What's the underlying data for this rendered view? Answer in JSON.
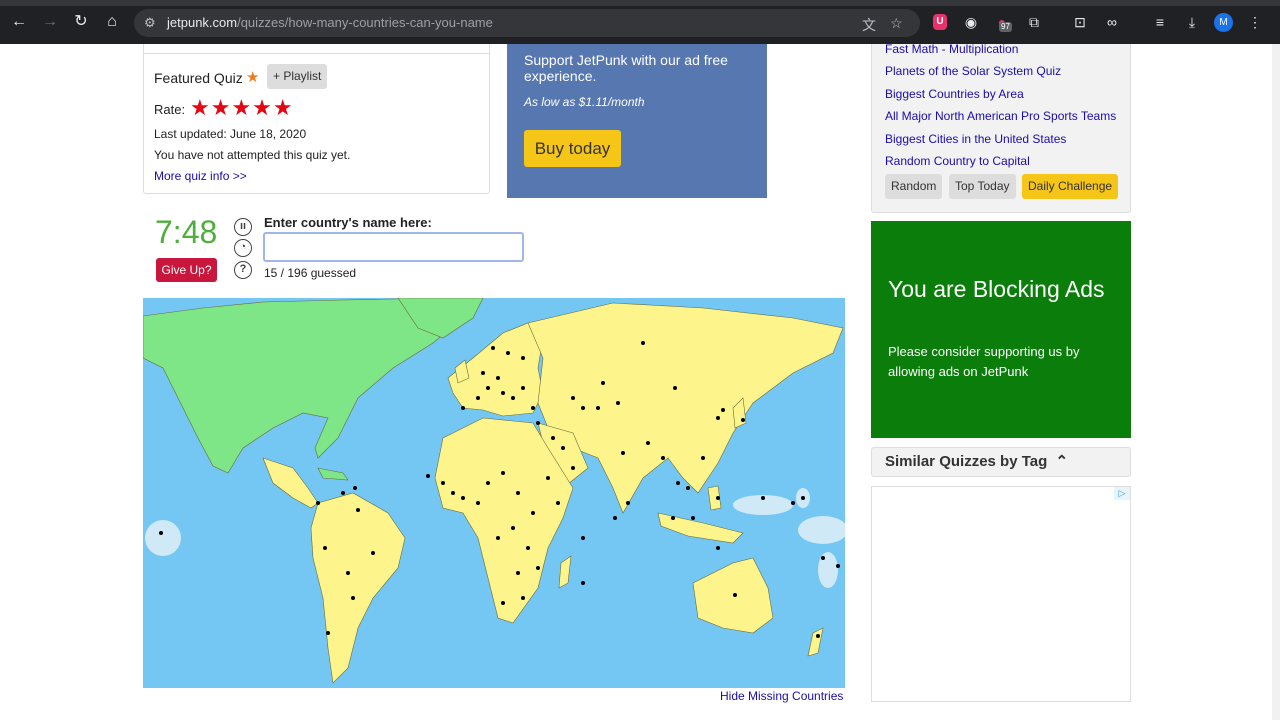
{
  "browser": {
    "url_host": "jetpunk.com",
    "url_path": "/quizzes/how-many-countries-can-you-name",
    "ext_badge": "97",
    "profile_initial": "M"
  },
  "quiz_info": {
    "featured_label": "Featured Quiz",
    "playlist_label": "+ Playlist",
    "rate_label": "Rate:",
    "stars": "★★★★★",
    "last_updated": "Last updated: June 18, 2020",
    "attempt_status": "You have not attempted this quiz yet.",
    "more_info_link": "More quiz info >>"
  },
  "promo": {
    "support_text": "Support JetPunk with our ad free experience.",
    "price_text": "As low as $1.11/month",
    "buy_label": "Buy today"
  },
  "game": {
    "timer": "7:48",
    "give_up_label": "Give Up?",
    "input_label": "Enter country's name here:",
    "input_value": "",
    "guessed_text": "15 / 196 guessed",
    "hide_missing_link": "Hide Missing Countries"
  },
  "sidebar": {
    "links": [
      "Fast Math - Multiplication",
      "Planets of the Solar System Quiz",
      "Biggest Countries by Area",
      "All Major North American Pro Sports Teams",
      "Biggest Cities in the United States",
      "Random Country to Capital"
    ],
    "buttons": {
      "random": "Random",
      "top_today": "Top Today",
      "daily_challenge": "Daily Challenge"
    }
  },
  "blocking_ad": {
    "heading": "You are Blocking Ads",
    "body": "Please consider supporting us by allowing ads on JetPunk"
  },
  "similar": {
    "heading": "Similar Quizzes by Tag",
    "chevron": "^"
  },
  "colors": {
    "ocean": "#74c6f3",
    "land_unguessed": "#fdf58b",
    "land_guessed": "#7ee686",
    "timer_green": "#4caf3a",
    "give_up_red": "#c8163c",
    "buy_yellow": "#f5c518",
    "blocking_ad_green": "#0a7d0a"
  }
}
